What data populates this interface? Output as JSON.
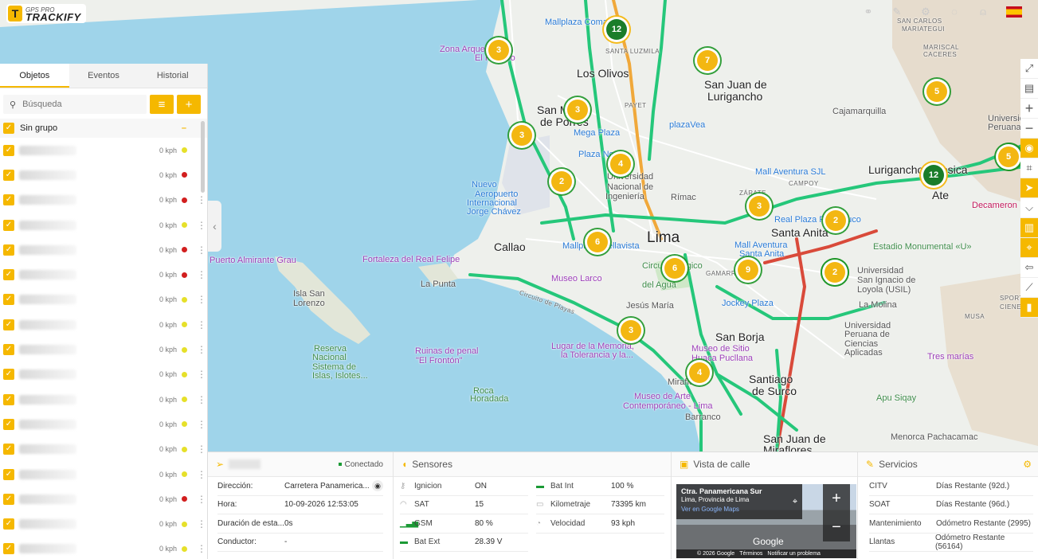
{
  "app": {
    "logo_top": "GPS PRO",
    "logo_name": "TRACKIFY",
    "logo_letter": "T"
  },
  "header_icons": [
    "share-icon",
    "wrench-icon",
    "gear-icon",
    "chat-icon",
    "user-icon",
    "flag-spain-icon"
  ],
  "tabs": [
    {
      "label": "Objetos",
      "active": true
    },
    {
      "label": "Eventos",
      "active": false
    },
    {
      "label": "Historial",
      "active": false
    }
  ],
  "search": {
    "placeholder": "Búsqueda"
  },
  "group": {
    "name": "Sin grupo",
    "toggle": "–"
  },
  "objects": [
    {
      "speed": "0 kph",
      "status": "yellow"
    },
    {
      "speed": "0 kph",
      "status": "red"
    },
    {
      "speed": "0 kph",
      "status": "red"
    },
    {
      "speed": "0 kph",
      "status": "yellow"
    },
    {
      "speed": "0 kph",
      "status": "red"
    },
    {
      "speed": "0 kph",
      "status": "red"
    },
    {
      "speed": "0 kph",
      "status": "yellow"
    },
    {
      "speed": "0 kph",
      "status": "yellow"
    },
    {
      "speed": "0 kph",
      "status": "yellow"
    },
    {
      "speed": "0 kph",
      "status": "yellow"
    },
    {
      "speed": "0 kph",
      "status": "yellow"
    },
    {
      "speed": "0 kph",
      "status": "yellow"
    },
    {
      "speed": "0 kph",
      "status": "yellow"
    },
    {
      "speed": "0 kph",
      "status": "yellow"
    },
    {
      "speed": "0 kph",
      "status": "red"
    },
    {
      "speed": "0 kph",
      "status": "yellow"
    },
    {
      "speed": "0 kph",
      "status": "yellow"
    }
  ],
  "map": {
    "labels": [
      {
        "t": "Mallplaza Comas",
        "c": "poi-blue"
      },
      {
        "t": "SANTA LUZMILA",
        "c": "small"
      },
      {
        "t": "Zona Arqueológica",
        "c": "poi-purple"
      },
      {
        "t": "El Paraíso",
        "c": "poi-purple"
      },
      {
        "t": "Los Olivos",
        "c": "big"
      },
      {
        "t": "PAYET",
        "c": "small"
      },
      {
        "t": "San Martín",
        "c": "big"
      },
      {
        "t": "de Porres",
        "c": "big"
      },
      {
        "t": "Mega Plaza",
        "c": "poi-blue"
      },
      {
        "t": "Plaza Norte",
        "c": "poi-blue"
      },
      {
        "t": "plazaVea",
        "c": "poi-blue"
      },
      {
        "t": "San Juan de",
        "c": "big"
      },
      {
        "t": "Lurigancho",
        "c": "big"
      },
      {
        "t": "Cajamarquilla",
        "c": ""
      },
      {
        "t": "Universidad",
        "c": ""
      },
      {
        "t": "Nacional de",
        "c": ""
      },
      {
        "t": "Ingeniería",
        "c": ""
      },
      {
        "t": "Rímac",
        "c": ""
      },
      {
        "t": "Nuevo",
        "c": "poi-blue"
      },
      {
        "t": "Aeropuerto",
        "c": "poi-blue"
      },
      {
        "t": "Internacional",
        "c": "poi-blue"
      },
      {
        "t": "Jorge Chávez",
        "c": "poi-blue"
      },
      {
        "t": "Mall Aventura SJL",
        "c": "poi-blue"
      },
      {
        "t": "CAMPOY",
        "c": "small"
      },
      {
        "t": "ZÁRATE",
        "c": "small"
      },
      {
        "t": "Lurigancho-Chosica",
        "c": "big"
      },
      {
        "t": "Ate",
        "c": "big"
      },
      {
        "t": "Decameron",
        "c": "poi-red"
      },
      {
        "t": "Callao",
        "c": "big"
      },
      {
        "t": "Lima",
        "c": "huge"
      },
      {
        "t": "Mallplaza Bellavista",
        "c": "poi-blue"
      },
      {
        "t": "Real Plaza Puruchuco",
        "c": "poi-blue"
      },
      {
        "t": "Santa Anita",
        "c": "big"
      },
      {
        "t": "Estadio Monumental «U»",
        "c": "poi-green"
      },
      {
        "t": "Mall Aventura",
        "c": "poi-blue"
      },
      {
        "t": "Santa Anita",
        "c": "poi-blue"
      },
      {
        "t": "Fortaleza del Real Felipe",
        "c": "poi-purple"
      },
      {
        "t": "Museo Larco",
        "c": "poi-purple"
      },
      {
        "t": "Circuito Mágico",
        "c": "poi-green"
      },
      {
        "t": "del Agua",
        "c": "poi-green"
      },
      {
        "t": "GAMARRA",
        "c": "small"
      },
      {
        "t": "Universidad",
        "c": ""
      },
      {
        "t": "San Ignacio de",
        "c": ""
      },
      {
        "t": "Loyola (USIL)",
        "c": ""
      },
      {
        "t": "Jesús María",
        "c": ""
      },
      {
        "t": "Jockey Plaza",
        "c": "poi-blue"
      },
      {
        "t": "La Molina",
        "c": ""
      },
      {
        "t": "La Punta",
        "c": ""
      },
      {
        "t": "Isla San",
        "c": ""
      },
      {
        "t": "Lorenzo",
        "c": ""
      },
      {
        "t": "San Borja",
        "c": "big"
      },
      {
        "t": "Universidad",
        "c": ""
      },
      {
        "t": "Peruana de",
        "c": ""
      },
      {
        "t": "Ciencias",
        "c": ""
      },
      {
        "t": "Aplicadas",
        "c": ""
      },
      {
        "t": "Reserva",
        "c": "poi-green"
      },
      {
        "t": "Nacional",
        "c": "poi-green"
      },
      {
        "t": "Sistema de",
        "c": "poi-green"
      },
      {
        "t": "Islas, Islotes...",
        "c": "poi-green"
      },
      {
        "t": "Ruinas de penal",
        "c": "poi-purple"
      },
      {
        "t": "\"El Frontón\"",
        "c": "poi-purple"
      },
      {
        "t": "Lugar de la Memoria,",
        "c": "poi-purple"
      },
      {
        "t": "la Tolerancia y la...",
        "c": "poi-purple"
      },
      {
        "t": "Museo de Sitio",
        "c": "poi-purple"
      },
      {
        "t": "Huaca Pucllana",
        "c": "poi-purple"
      },
      {
        "t": "Santiago",
        "c": "big"
      },
      {
        "t": "de Surco",
        "c": "big"
      },
      {
        "t": "Tres marías",
        "c": "poi-purple"
      },
      {
        "t": "Miraflores",
        "c": ""
      },
      {
        "t": "Roca",
        "c": "poi-green"
      },
      {
        "t": "Horadada",
        "c": "poi-green"
      },
      {
        "t": "Museo de Arte",
        "c": "poi-purple"
      },
      {
        "t": "Contemporáneo - Lima",
        "c": "poi-purple"
      },
      {
        "t": "Apu Siqay",
        "c": "poi-green"
      },
      {
        "t": "Barranco",
        "c": ""
      },
      {
        "t": "San Juan de",
        "c": "big"
      },
      {
        "t": "Miraflores",
        "c": "big"
      },
      {
        "t": "Menorca Pachacamac",
        "c": ""
      },
      {
        "t": "SAN CARLOS",
        "c": "small"
      },
      {
        "t": "MARIATEGUI",
        "c": "small"
      },
      {
        "t": "MARISCAL",
        "c": "small"
      },
      {
        "t": "CACERES",
        "c": "small"
      },
      {
        "t": "Universidad",
        "c": ""
      },
      {
        "t": "Peruana Unión",
        "c": ""
      },
      {
        "t": "Puerto Almirante Grau",
        "c": "poi-purple"
      },
      {
        "t": "SPORT",
        "c": "small"
      },
      {
        "t": "CIENEGUILLA",
        "c": "small"
      },
      {
        "t": "MUSA",
        "c": "small"
      },
      {
        "t": "Circuito de Playas",
        "c": "small"
      }
    ],
    "clusters": [
      "12",
      "3",
      "7",
      "5",
      "3",
      "3",
      "4",
      "2",
      "2",
      "12",
      "2",
      "3",
      "2",
      "5",
      "6",
      "6",
      "9",
      "2",
      "3",
      "4"
    ]
  },
  "right_toolbar": [
    "fullscreen-icon",
    "map-layers-icon",
    "zoom-in-icon",
    "zoom-out-icon",
    "traffic-icon",
    "crop-icon",
    "navigate-icon",
    "route-icon",
    "road-icon",
    "poi-icon",
    "back-icon",
    "measure-icon",
    "device-icon"
  ],
  "device": {
    "status": "Conectado",
    "rows": [
      {
        "k": "Dirección:",
        "v": "Carretera Panamerica..."
      },
      {
        "k": "Hora:",
        "v": "10-09-2026 12:53:05"
      },
      {
        "k": "Duración de esta...",
        "v": "0s"
      },
      {
        "k": "Conductor:",
        "v": "-"
      }
    ]
  },
  "sensors": {
    "title": "Sensores",
    "items": [
      {
        "k": "Ignicion",
        "v": "ON",
        "icon": "key-icon"
      },
      {
        "k": "Bat Int",
        "v": "100 %",
        "icon": "battery-icon"
      },
      {
        "k": "SAT",
        "v": "15",
        "icon": "satellite-icon"
      },
      {
        "k": "Kilometraje",
        "v": "73395 km",
        "icon": "odometer-icon"
      },
      {
        "k": "GSM",
        "v": "80 %",
        "icon": "signal-icon"
      },
      {
        "k": "Velocidad",
        "v": "93 kph",
        "icon": "speedometer-icon"
      },
      {
        "k": "Bat Ext",
        "v": "28.39 V",
        "icon": "battery-icon"
      }
    ]
  },
  "street": {
    "title": "Vista de calle",
    "place": "Ctra. Panamericana Sur",
    "city": "Lima, Provincia de Lima",
    "link": "Ver en Google Maps",
    "logo": "Google",
    "copyright": "© 2026 Google",
    "terms": "Términos",
    "report": "Notificar un problema"
  },
  "services": {
    "title": "Servicios",
    "rows": [
      {
        "k": "CITV",
        "v": "Días Restante (92d.)"
      },
      {
        "k": "SOAT",
        "v": "Días Restante (96d.)"
      },
      {
        "k": "Mantenimiento",
        "v": "Odómetro Restante (2995)"
      },
      {
        "k": "Llantas",
        "v": "Odómetro Restante (56164)"
      }
    ]
  }
}
